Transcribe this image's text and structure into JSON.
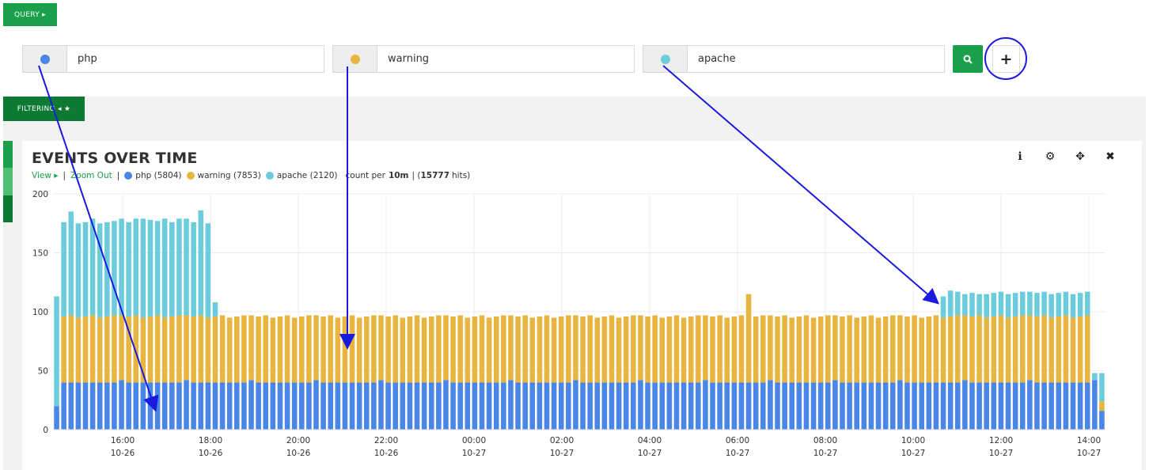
{
  "query_tab": {
    "label": "QUERY ▸"
  },
  "queries": [
    {
      "label": "php",
      "color": "#4a86e8"
    },
    {
      "label": "warning",
      "color": "#e8b540"
    },
    {
      "label": "apache",
      "color": "#6cccdc"
    }
  ],
  "filter_tab": {
    "label": "FILTERING ◂ ★"
  },
  "panel": {
    "title": "EVENTS OVER TIME",
    "view_label": "View ▸",
    "zoom_label": "Zoom Out",
    "legend": [
      {
        "label": "php (5804)",
        "color": "#4a86e8"
      },
      {
        "label": "warning (7853)",
        "color": "#e8b540"
      },
      {
        "label": "apache (2120)",
        "color": "#6cccdc"
      }
    ],
    "count_prefix": "count per",
    "count_interval": "10m",
    "hits_open": "| (",
    "hits_value": "15777",
    "hits_close": "hits)"
  },
  "chart_data": {
    "type": "bar",
    "stacked": true,
    "ylim": [
      0,
      200
    ],
    "yticks": [
      0,
      50,
      100,
      150,
      200
    ],
    "xticks": [
      {
        "time": "16:00",
        "date": "10-26"
      },
      {
        "time": "18:00",
        "date": "10-26"
      },
      {
        "time": "20:00",
        "date": "10-26"
      },
      {
        "time": "22:00",
        "date": "10-26"
      },
      {
        "time": "00:00",
        "date": "10-27"
      },
      {
        "time": "02:00",
        "date": "10-27"
      },
      {
        "time": "04:00",
        "date": "10-27"
      },
      {
        "time": "06:00",
        "date": "10-27"
      },
      {
        "time": "08:00",
        "date": "10-27"
      },
      {
        "time": "10:00",
        "date": "10-27"
      },
      {
        "time": "12:00",
        "date": "10-27"
      },
      {
        "time": "14:00",
        "date": "10-27"
      }
    ],
    "series": [
      {
        "name": "php",
        "color": "#4a86e8",
        "baseline": 40,
        "overrides": {
          "0": 20,
          "144": 42,
          "145": 16
        }
      },
      {
        "name": "warning",
        "color": "#e8b540",
        "baseline": 55,
        "overrides": {
          "0": 0,
          "144": 0,
          "145": 8,
          "96": 75
        }
      },
      {
        "name": "apache",
        "color": "#6cccdc",
        "overrides": {
          "0": 93,
          "1": 80,
          "2": 88,
          "3": 80,
          "4": 80,
          "5": 82,
          "6": 80,
          "7": 80,
          "8": 80,
          "9": 82,
          "10": 80,
          "11": 82,
          "12": 84,
          "13": 82,
          "14": 80,
          "15": 84,
          "16": 80,
          "17": 82,
          "18": 82,
          "19": 80,
          "20": 89,
          "21": 80,
          "22": 12,
          "123": 18,
          "124": 22,
          "125": 20,
          "126": 18,
          "127": 20,
          "128": 18,
          "129": 20,
          "130": 20,
          "131": 20,
          "132": 20,
          "133": 20,
          "134": 20,
          "135": 20,
          "136": 20,
          "137": 20,
          "138": 20,
          "139": 20,
          "140": 20,
          "141": 20,
          "142": 20,
          "143": 20,
          "144": 6,
          "145": 24
        }
      }
    ],
    "bar_count": 146
  }
}
